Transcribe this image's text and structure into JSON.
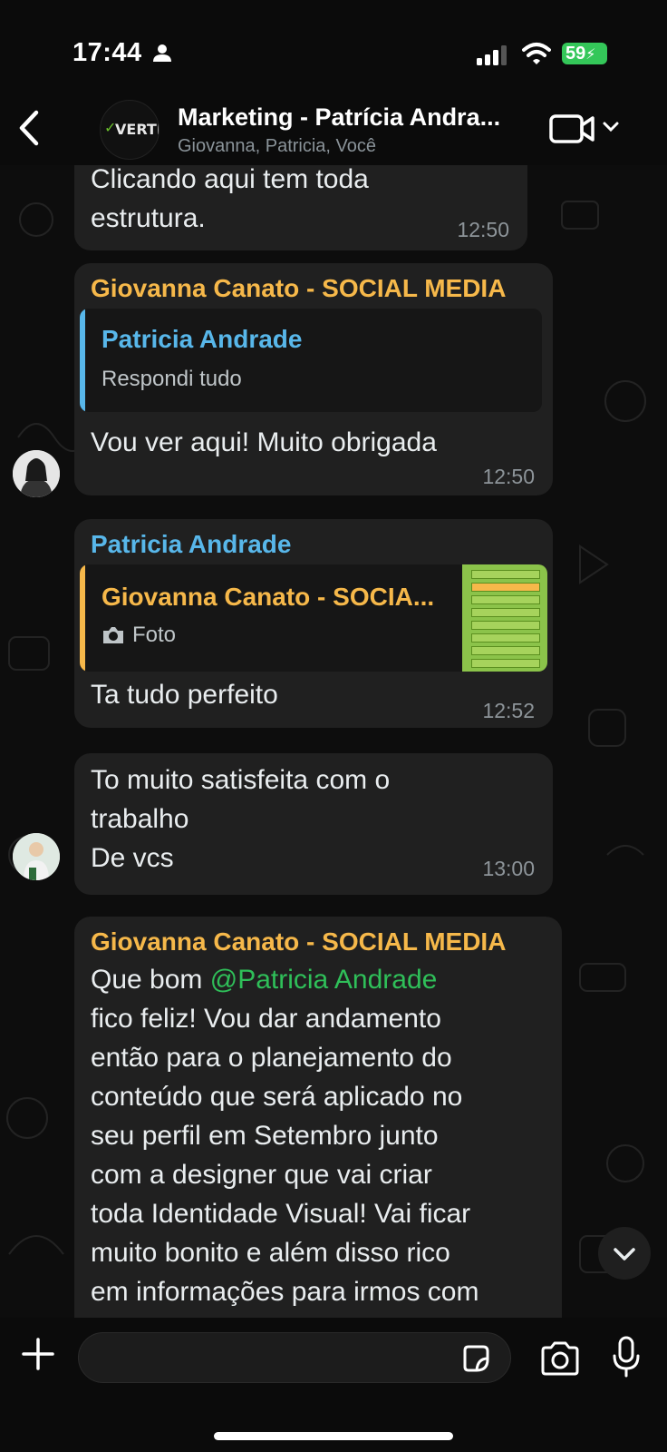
{
  "status_bar": {
    "time": "17:44",
    "battery": "59"
  },
  "header": {
    "group_name": "Marketing - Patrícia Andra...",
    "members": "Giovanna, Patricia, Você",
    "avatar_logo_text": "VERTI"
  },
  "messages": [
    {
      "lines": [
        "Clicando aqui tem toda",
        "estrutura."
      ],
      "time": "12:50"
    },
    {
      "sender": "Giovanna Canato - SOCIAL MEDIA",
      "quote": {
        "name": "Patricia Andrade",
        "text": "Respondi tudo"
      },
      "text": "Vou ver aqui! Muito obrigada",
      "time": "12:50"
    },
    {
      "sender": "Patricia Andrade",
      "quote": {
        "name": "Giovanna Canato - SOCIA...",
        "text": "Foto"
      },
      "text": "Ta tudo perfeito",
      "time": "12:52"
    },
    {
      "lines": [
        "To muito satisfeita com o",
        "trabalho",
        "De vcs"
      ],
      "time": "13:00"
    },
    {
      "sender": "Giovanna Canato - SOCIAL MEDIA",
      "first_line_prefix": "Que bom ",
      "mention": "@Patricia Andrade",
      "lines": [
        "fico feliz! Vou dar andamento",
        "então para o planejamento do",
        "conteúdo que será aplicado no",
        "seu perfil em Setembro junto",
        "com a designer que vai criar",
        "toda Identidade Visual! Vai ficar",
        "muito bonito e além disso rico",
        "em informações para irmos com"
      ]
    }
  ],
  "colors": {
    "sender_orange": "#f6b84a",
    "sender_blue": "#58b7ea",
    "mention_green": "#2fbf59",
    "bubble": "#202020"
  },
  "icons": {
    "back": "chevron-left-icon",
    "video": "video-call-icon",
    "plus": "plus-icon",
    "sticker": "sticker-icon",
    "camera": "camera-icon",
    "mic": "microphone-icon"
  }
}
